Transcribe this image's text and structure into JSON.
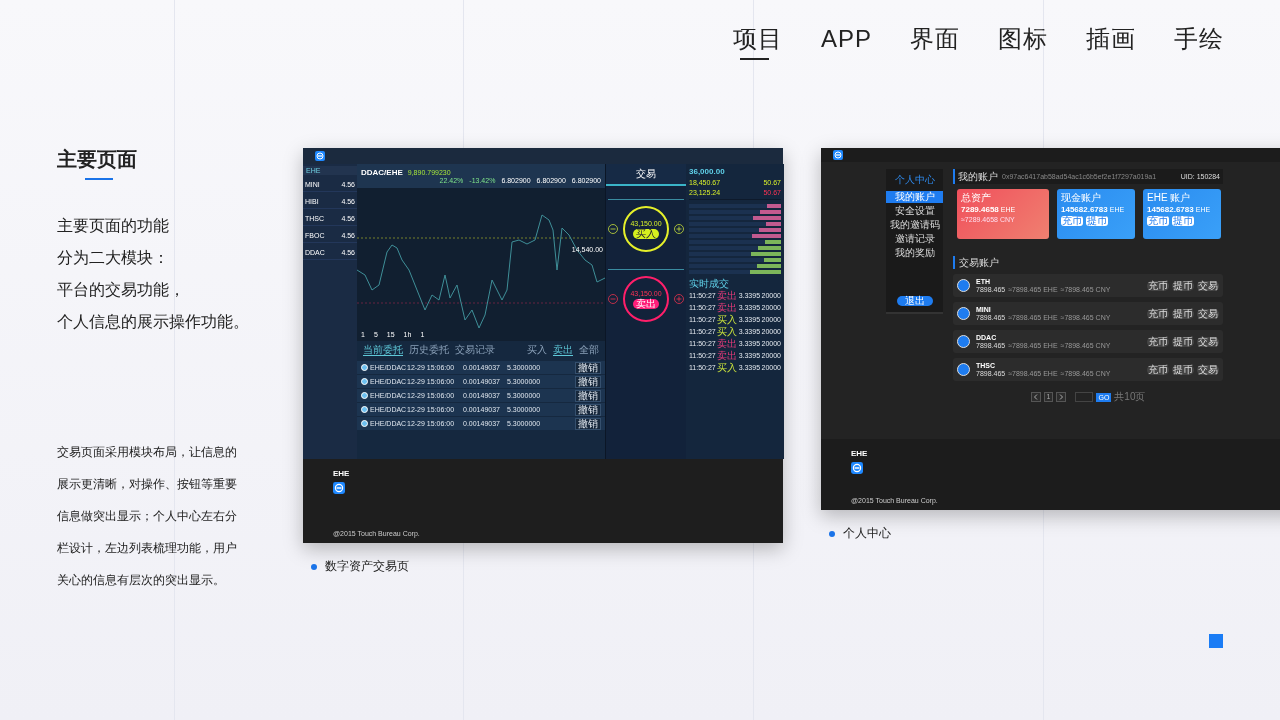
{
  "nav": [
    {
      "label": "项目",
      "selected": true
    },
    {
      "label": "APP",
      "selected": false
    },
    {
      "label": "界面",
      "selected": false
    },
    {
      "label": "图标",
      "selected": false
    },
    {
      "label": "插画",
      "selected": false
    },
    {
      "label": "手绘",
      "selected": false
    }
  ],
  "intro": {
    "title": "主要页面",
    "lines": [
      "主要页面的功能",
      "分为二大模块：",
      "平台的交易功能，",
      "个人信息的展示操作功能。"
    ],
    "description": "交易页面采用模块布局，让信息的展示更清晰，对操作、按钮等重要信息做突出显示；个人中心左右分栏设计，左边列表梳理功能，用户关心的信息有层次的突出显示。"
  },
  "trade_mockup": {
    "caption": "数字资产交易页",
    "market": "EHE",
    "coins": [
      {
        "name": "MINI",
        "price": "4.56"
      },
      {
        "name": "HIBI",
        "price": "4.56"
      },
      {
        "name": "THSC",
        "price": "4.56"
      },
      {
        "name": "FBOC",
        "price": "4.56"
      },
      {
        "name": "DDAC",
        "price": "4.56"
      }
    ],
    "pair": "DDAC/EHE",
    "last_price": "9,890.799230",
    "stats": [
      "22.42%",
      "-13.42%",
      "6.802900",
      "6.802900",
      "6.802900"
    ],
    "price_label": "14,540.00",
    "intervals": [
      "1",
      "5",
      "15",
      "1h",
      "1"
    ],
    "order_tabs": [
      {
        "label": "当前委托",
        "selected": true
      },
      {
        "label": "历史委托",
        "selected": false
      },
      {
        "label": "交易记录",
        "selected": false
      }
    ],
    "order_filters": [
      {
        "label": "买入",
        "selected": false
      },
      {
        "label": "卖出",
        "selected": true
      },
      {
        "label": "全部",
        "selected": false
      }
    ],
    "orders": [
      {
        "pair": "EHE/DDAC",
        "time": "12-29 15:06:00",
        "price": "0.00149037",
        "amount": "5.3000000",
        "action": "撤销"
      },
      {
        "pair": "EHE/DDAC",
        "time": "12-29 15:06:00",
        "price": "0.00149037",
        "amount": "5.3000000",
        "action": "撤销"
      },
      {
        "pair": "EHE/DDAC",
        "time": "12-29 15:06:00",
        "price": "0.00149037",
        "amount": "5.3000000",
        "action": "撤销"
      },
      {
        "pair": "EHE/DDAC",
        "time": "12-29 15:06:00",
        "price": "0.00149037",
        "amount": "5.3000000",
        "action": "撤销"
      },
      {
        "pair": "EHE/DDAC",
        "time": "12-29 15:06:00",
        "price": "0.00149037",
        "amount": "5.3000000",
        "action": "撤销"
      }
    ],
    "trade_title": "交易",
    "buy": {
      "price": "43,150.00",
      "button": "买入"
    },
    "sell": {
      "price": "43,150.00",
      "button": "卖出"
    },
    "assets": {
      "total": "36,000.00",
      "first": "18,450.67",
      "second": "50.67",
      "limit_up": "23,125.24",
      "limit_down": "50.67"
    },
    "trades_title": "实时成交",
    "trades": [
      {
        "time": "11:50:27",
        "side": "卖出",
        "kind": "sell",
        "price": "3.3395",
        "amount": "20000"
      },
      {
        "time": "11:50:27",
        "side": "卖出",
        "kind": "sell",
        "price": "3.3395",
        "amount": "20000"
      },
      {
        "time": "11:50:27",
        "side": "买入",
        "kind": "buy",
        "price": "3.3395",
        "amount": "20000"
      },
      {
        "time": "11:50:27",
        "side": "买入",
        "kind": "buy",
        "price": "3.3395",
        "amount": "20000"
      },
      {
        "time": "11:50:27",
        "side": "卖出",
        "kind": "sell",
        "price": "3.3395",
        "amount": "20000"
      },
      {
        "time": "11:50:27",
        "side": "卖出",
        "kind": "sell",
        "price": "3.3395",
        "amount": "20000"
      },
      {
        "time": "11:50:27",
        "side": "买入",
        "kind": "buy",
        "price": "3.3395",
        "amount": "20000"
      }
    ],
    "footer": {
      "brand": "EHE",
      "copyright": "@2015 Touch Bureau Corp."
    }
  },
  "account_mockup": {
    "caption": "个人中心",
    "menu_title": "个人中心",
    "menu": [
      {
        "label": "我的账户",
        "selected": true
      },
      {
        "label": "安全设置",
        "selected": false
      },
      {
        "label": "我的邀请码",
        "selected": false
      },
      {
        "label": "邀请记录",
        "selected": false
      },
      {
        "label": "我的奖励",
        "selected": false
      }
    ],
    "logout": "退出",
    "header": {
      "title": "我的账户",
      "address": "0x97ac6417ab58ad54ac1c6b5ef2e1f7297a019a1",
      "uid": "UID: 150284"
    },
    "cards": [
      {
        "title": "总资产",
        "kind": "total",
        "value": "7289.4658",
        "unit": "EHE",
        "sub": "≈7289.4658 CNY"
      },
      {
        "title": "现金账户",
        "kind": "wallet",
        "value": "145682.6783",
        "unit": "EHE",
        "buttons": [
          "充币",
          "提币"
        ]
      },
      {
        "title": "EHE 账户",
        "kind": "wallet",
        "value": "145682.6783",
        "unit": "EHE",
        "buttons": [
          "充币",
          "提币"
        ]
      }
    ],
    "section_title": "交易账户",
    "coins": [
      {
        "name": "ETH",
        "balance": "7898.465",
        "ehe": "≈7898.465 EHE",
        "cny": "≈7898.465 CNY",
        "buttons": [
          "充币",
          "提币",
          "交易"
        ]
      },
      {
        "name": "MINI",
        "balance": "7898.465",
        "ehe": "≈7898.465 EHE",
        "cny": "≈7898.465 CNY",
        "buttons": [
          "充币",
          "提币",
          "交易"
        ]
      },
      {
        "name": "DDAC",
        "balance": "7898.465",
        "ehe": "≈7898.465 EHE",
        "cny": "≈7898.465 CNY",
        "buttons": [
          "充币",
          "提币",
          "交易"
        ]
      },
      {
        "name": "THSC",
        "balance": "7898.465",
        "ehe": "≈7898.465 EHE",
        "cny": "≈7898.465 CNY",
        "buttons": [
          "充币",
          "提币",
          "交易"
        ]
      }
    ],
    "pagination": {
      "page": "1",
      "go": "GO",
      "total": "共10页"
    },
    "footer": {
      "brand": "EHE",
      "copyright": "@2015 Touch Bureau Corp."
    }
  }
}
